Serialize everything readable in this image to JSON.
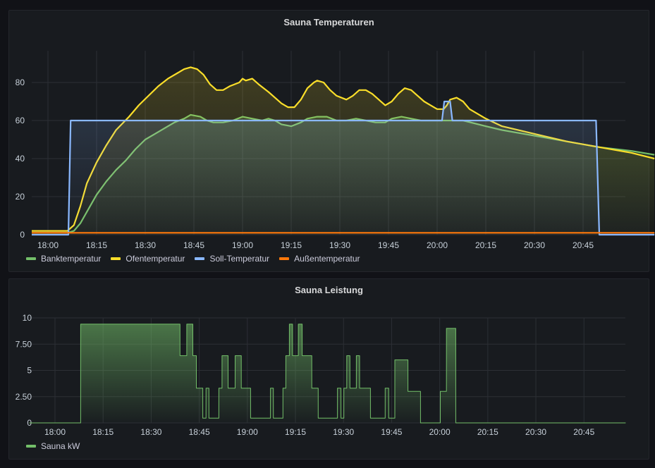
{
  "colors": {
    "green": "#73bf69",
    "yellow": "#fade2a",
    "blue": "#8ab8ff",
    "orange": "#ff780a",
    "grid": "#2c2f35"
  },
  "chart_data": [
    {
      "type": "line",
      "title": "Sauna Temperaturen",
      "x_unit": "minutes since 18:00",
      "x_range": [
        -5,
        187
      ],
      "x_ticks": [
        {
          "m": 0,
          "label": "18:00"
        },
        {
          "m": 15,
          "label": "18:15"
        },
        {
          "m": 30,
          "label": "18:30"
        },
        {
          "m": 45,
          "label": "18:45"
        },
        {
          "m": 60,
          "label": "19:00"
        },
        {
          "m": 75,
          "label": "19:15"
        },
        {
          "m": 90,
          "label": "19:30"
        },
        {
          "m": 105,
          "label": "19:45"
        },
        {
          "m": 120,
          "label": "20:00"
        },
        {
          "m": 135,
          "label": "20:15"
        },
        {
          "m": 150,
          "label": "20:30"
        },
        {
          "m": 165,
          "label": "20:45"
        }
      ],
      "y_ticks": [
        {
          "v": 0,
          "label": "0"
        },
        {
          "v": 20,
          "label": "20"
        },
        {
          "v": 40,
          "label": "40"
        },
        {
          "v": 60,
          "label": "60"
        },
        {
          "v": 80,
          "label": "80"
        }
      ],
      "ylim": [
        0,
        97
      ],
      "grid": true,
      "legend_placement": "bottom-left",
      "series": [
        {
          "name": "Banktemperatur",
          "color": "#73bf69",
          "fill": true,
          "points": [
            [
              -5,
              1
            ],
            [
              6,
              1
            ],
            [
              8,
              2
            ],
            [
              10,
              6
            ],
            [
              12,
              12
            ],
            [
              15,
              21
            ],
            [
              18,
              28
            ],
            [
              21,
              34
            ],
            [
              24,
              39
            ],
            [
              27,
              45
            ],
            [
              30,
              50
            ],
            [
              33,
              53
            ],
            [
              36,
              56
            ],
            [
              39,
              59
            ],
            [
              42,
              61
            ],
            [
              44,
              63
            ],
            [
              47,
              62
            ],
            [
              49,
              60
            ],
            [
              51,
              59
            ],
            [
              54,
              59
            ],
            [
              57,
              60
            ],
            [
              60,
              62
            ],
            [
              63,
              61
            ],
            [
              66,
              60
            ],
            [
              68,
              61
            ],
            [
              70,
              60
            ],
            [
              72,
              58
            ],
            [
              75,
              57
            ],
            [
              78,
              59
            ],
            [
              80,
              61
            ],
            [
              83,
              62
            ],
            [
              86,
              62
            ],
            [
              89,
              60
            ],
            [
              92,
              60
            ],
            [
              95,
              61
            ],
            [
              98,
              60
            ],
            [
              101,
              59
            ],
            [
              104,
              59
            ],
            [
              106,
              61
            ],
            [
              109,
              62
            ],
            [
              112,
              61
            ],
            [
              115,
              60
            ],
            [
              120,
              60
            ],
            [
              125,
              60
            ],
            [
              128,
              60
            ],
            [
              135,
              57
            ],
            [
              140,
              55
            ],
            [
              150,
              52
            ],
            [
              160,
              49
            ],
            [
              170,
              46
            ],
            [
              180,
              44
            ],
            [
              187,
              42
            ]
          ]
        },
        {
          "name": "Ofentemperatur",
          "color": "#fade2a",
          "fill": true,
          "points": [
            [
              -5,
              2
            ],
            [
              6,
              2
            ],
            [
              8,
              5
            ],
            [
              10,
              15
            ],
            [
              12,
              27
            ],
            [
              15,
              38
            ],
            [
              18,
              47
            ],
            [
              21,
              55
            ],
            [
              25,
              62
            ],
            [
              28,
              68
            ],
            [
              31,
              73
            ],
            [
              34,
              78
            ],
            [
              37,
              82
            ],
            [
              40,
              85
            ],
            [
              42,
              87
            ],
            [
              44,
              88
            ],
            [
              46,
              87
            ],
            [
              48,
              84
            ],
            [
              50,
              79
            ],
            [
              52,
              76
            ],
            [
              54,
              76
            ],
            [
              56,
              78
            ],
            [
              59,
              80
            ],
            [
              60,
              82
            ],
            [
              61,
              81
            ],
            [
              63,
              82
            ],
            [
              65,
              79
            ],
            [
              68,
              75
            ],
            [
              70,
              72
            ],
            [
              72,
              69
            ],
            [
              74,
              67
            ],
            [
              76,
              67
            ],
            [
              78,
              71
            ],
            [
              80,
              77
            ],
            [
              82,
              80
            ],
            [
              83,
              81
            ],
            [
              85,
              80
            ],
            [
              87,
              76
            ],
            [
              89,
              73
            ],
            [
              92,
              71
            ],
            [
              94,
              73
            ],
            [
              96,
              76
            ],
            [
              98,
              76
            ],
            [
              100,
              74
            ],
            [
              102,
              71
            ],
            [
              104,
              68
            ],
            [
              106,
              70
            ],
            [
              108,
              74
            ],
            [
              110,
              77
            ],
            [
              112,
              76
            ],
            [
              114,
              73
            ],
            [
              116,
              70
            ],
            [
              118,
              68
            ],
            [
              120,
              66
            ],
            [
              122,
              66
            ],
            [
              123,
              68
            ],
            [
              124,
              71
            ],
            [
              126,
              72
            ],
            [
              128,
              70
            ],
            [
              130,
              66
            ],
            [
              135,
              61
            ],
            [
              140,
              57
            ],
            [
              150,
              53
            ],
            [
              160,
              49
            ],
            [
              170,
              46
            ],
            [
              180,
              43
            ],
            [
              187,
              40
            ]
          ]
        },
        {
          "name": "Soll-Temperatur",
          "color": "#8ab8ff",
          "fill": true,
          "points": [
            [
              -5,
              0
            ],
            [
              6.3,
              0
            ],
            [
              7,
              60
            ],
            [
              121.5,
              60
            ],
            [
              122.2,
              70
            ],
            [
              124,
              70
            ],
            [
              124.7,
              60
            ],
            [
              169,
              60
            ],
            [
              170,
              0
            ],
            [
              187,
              0
            ]
          ]
        },
        {
          "name": "Außentemperatur",
          "color": "#ff780a",
          "fill": false,
          "points": [
            [
              -5,
              1
            ],
            [
              187,
              1
            ]
          ]
        }
      ]
    },
    {
      "type": "area",
      "title": "Sauna Leistung",
      "x_unit": "minutes since 18:00",
      "x_range": [
        -8,
        178
      ],
      "x_ticks": [
        {
          "m": 0,
          "label": "18:00"
        },
        {
          "m": 15,
          "label": "18:15"
        },
        {
          "m": 30,
          "label": "18:30"
        },
        {
          "m": 45,
          "label": "18:45"
        },
        {
          "m": 60,
          "label": "19:00"
        },
        {
          "m": 75,
          "label": "19:15"
        },
        {
          "m": 90,
          "label": "19:30"
        },
        {
          "m": 105,
          "label": "19:45"
        },
        {
          "m": 120,
          "label": "20:00"
        },
        {
          "m": 135,
          "label": "20:15"
        },
        {
          "m": 150,
          "label": "20:30"
        },
        {
          "m": 165,
          "label": "20:45"
        }
      ],
      "y_ticks": [
        {
          "v": 0,
          "label": "0"
        },
        {
          "v": 2.5,
          "label": "2.50"
        },
        {
          "v": 5,
          "label": "5"
        },
        {
          "v": 7.5,
          "label": "7.50"
        },
        {
          "v": 10,
          "label": "10"
        }
      ],
      "ylim": [
        0,
        10
      ],
      "grid": true,
      "legend_placement": "bottom-left",
      "series": [
        {
          "name": "Sauna kW",
          "color": "#73bf69",
          "step": true,
          "points": [
            [
              -8,
              0
            ],
            [
              8,
              9.4
            ],
            [
              39,
              6.4
            ],
            [
              41.1,
              9.4
            ],
            [
              43,
              6.4
            ],
            [
              44.1,
              3.3
            ],
            [
              46.1,
              0.45
            ],
            [
              47.1,
              3.3
            ],
            [
              48,
              0.45
            ],
            [
              51.1,
              3.3
            ],
            [
              52.1,
              6.4
            ],
            [
              54,
              3.3
            ],
            [
              56.2,
              6.4
            ],
            [
              58.1,
              3.3
            ],
            [
              61,
              0.45
            ],
            [
              67.2,
              3.3
            ],
            [
              68.1,
              0.45
            ],
            [
              71.1,
              3.3
            ],
            [
              72,
              6.4
            ],
            [
              73.1,
              9.4
            ],
            [
              74.1,
              6.4
            ],
            [
              75.9,
              9.4
            ],
            [
              77.1,
              6.4
            ],
            [
              80.1,
              3.3
            ],
            [
              82.1,
              0.45
            ],
            [
              88.1,
              3.3
            ],
            [
              89.2,
              0.45
            ],
            [
              90.1,
              3.3
            ],
            [
              91,
              6.4
            ],
            [
              92,
              3.3
            ],
            [
              94,
              6.4
            ],
            [
              95,
              3.3
            ],
            [
              98.4,
              0.45
            ],
            [
              103,
              3.3
            ],
            [
              104.1,
              0.45
            ],
            [
              106,
              6
            ],
            [
              110.1,
              3
            ],
            [
              114,
              0
            ],
            [
              120.2,
              3
            ],
            [
              122.1,
              9
            ],
            [
              125,
              0
            ],
            [
              178,
              0
            ]
          ]
        }
      ]
    }
  ]
}
